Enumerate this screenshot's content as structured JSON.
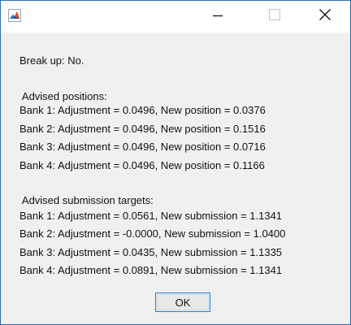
{
  "window": {
    "title": "",
    "icon": "matlab-icon",
    "controls": {
      "minimize": "minimize-icon",
      "maximize": "maximize-icon",
      "close": "close-icon"
    }
  },
  "dialog": {
    "break_up": "Break up: No.",
    "positions_heading": " Advised positions:",
    "positions": [
      "Bank 1: Adjustment = 0.0496, New position = 0.0376",
      "Bank 2: Adjustment = 0.0496, New position = 0.1516",
      "Bank 3: Adjustment = 0.0496, New position = 0.0716",
      "Bank 4: Adjustment = 0.0496, New position = 0.1166"
    ],
    "targets_heading": " Advised submission targets:",
    "targets": [
      "Bank 1: Adjustment = 0.0561, New submission = 1.1341",
      "Bank 2: Adjustment = -0.0000, New submission = 1.0400",
      "Bank 3: Adjustment = 0.0435, New submission = 1.1335",
      "Bank 4: Adjustment = 0.0891, New submission = 1.1341"
    ],
    "ok_label": "OK"
  }
}
